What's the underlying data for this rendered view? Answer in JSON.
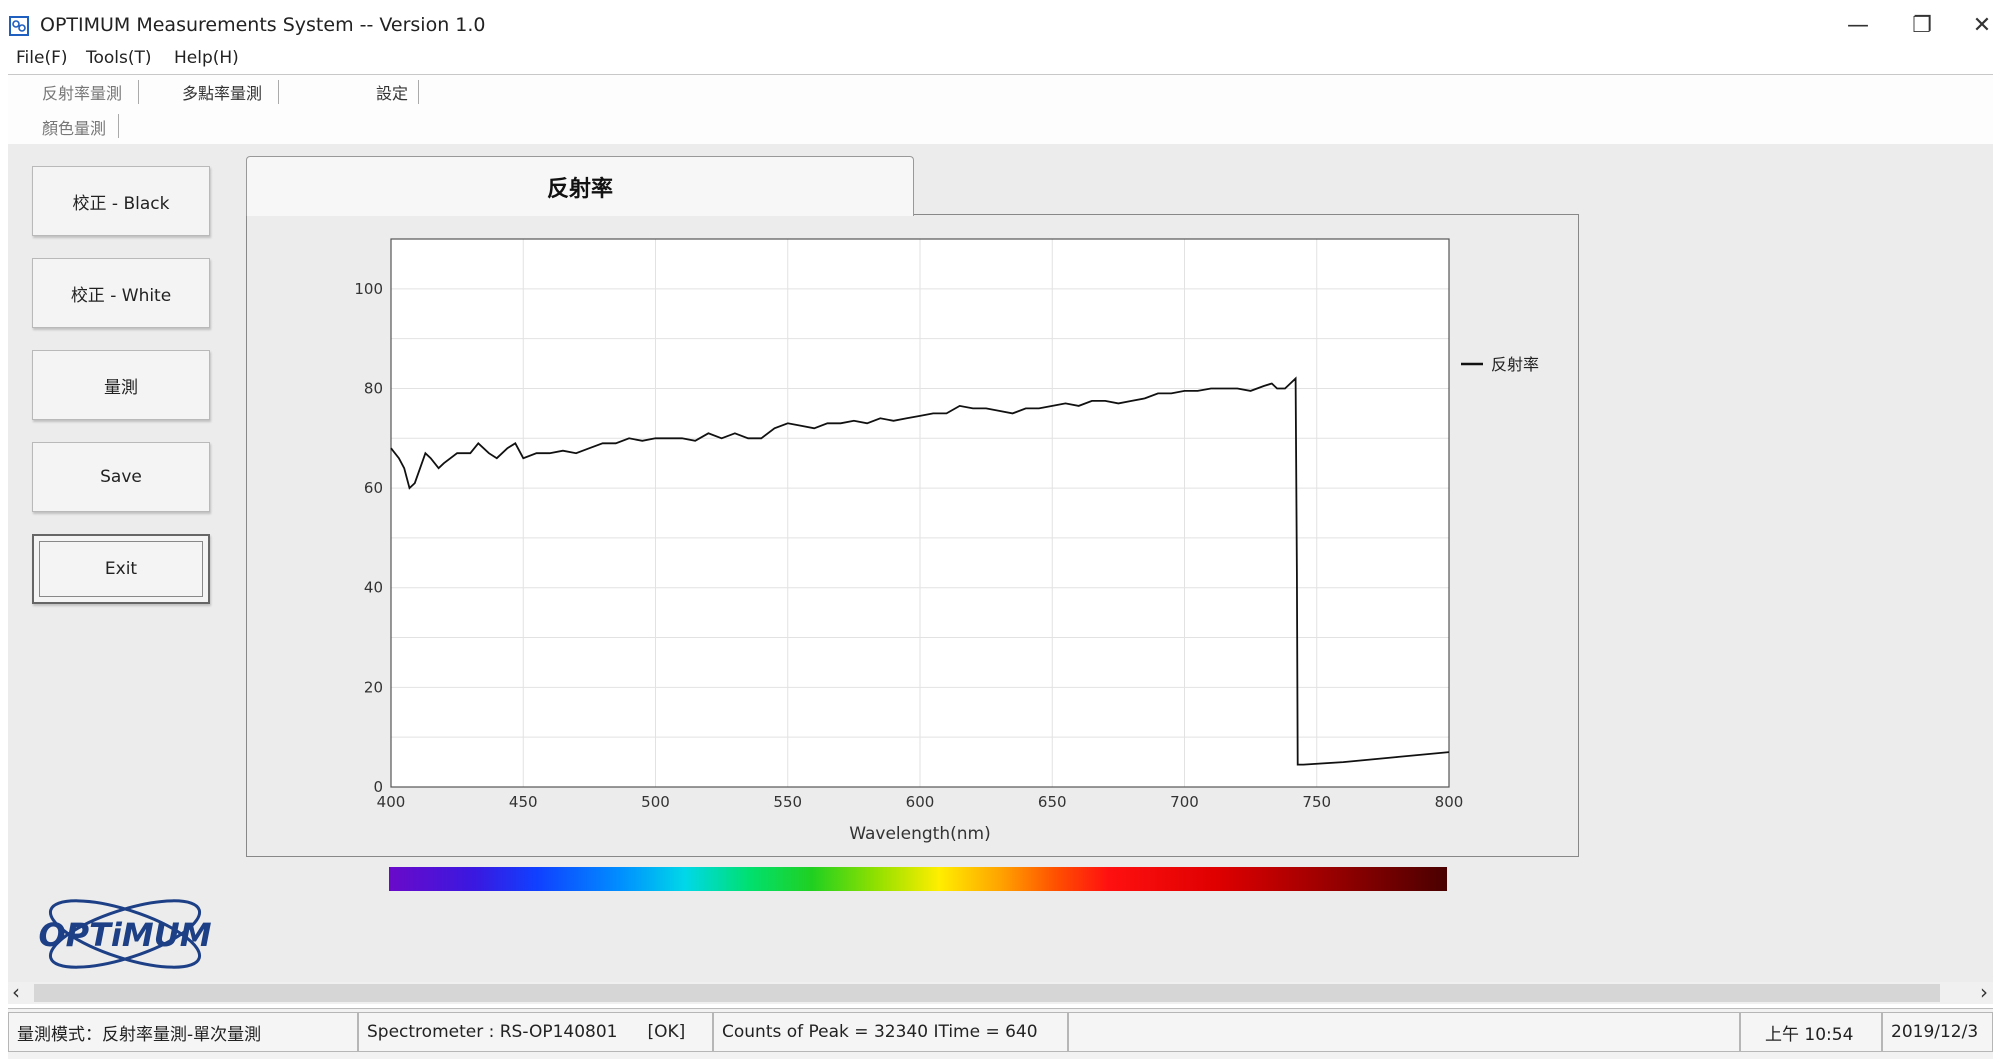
{
  "window": {
    "title": "OPTIMUM Measurements System -- Version 1.0",
    "minimize_glyph": "—",
    "restore_glyph": "❐",
    "close_glyph": "✕"
  },
  "menu": [
    {
      "label": "File(F)"
    },
    {
      "label": "Tools(T)"
    },
    {
      "label": "Help(H)"
    }
  ],
  "toolbar": {
    "tabs_row1": [
      {
        "label": "反射率量測"
      },
      {
        "label": "多點率量測"
      },
      {
        "label": "設定"
      }
    ],
    "tabs_row2": [
      {
        "label": "顏色量測"
      }
    ]
  },
  "sidebar": {
    "buttons": [
      {
        "label": "校正 - Black"
      },
      {
        "label": "校正 - White"
      },
      {
        "label": "量測"
      },
      {
        "label": "Save"
      },
      {
        "label": "Exit"
      }
    ]
  },
  "chart_tab": {
    "label": "反射率"
  },
  "chart_data": {
    "type": "line",
    "title": "",
    "xlabel": "Wavelength(nm)",
    "ylabel": "",
    "xlim": [
      400,
      800
    ],
    "ylim": [
      0,
      110
    ],
    "xticks": [
      400,
      450,
      500,
      550,
      600,
      650,
      700,
      750,
      800
    ],
    "yticks": [
      0,
      20,
      40,
      60,
      80,
      100
    ],
    "grid": true,
    "legend_position": "right",
    "series": [
      {
        "name": "反射率",
        "color": "#111111",
        "points": [
          [
            400,
            68
          ],
          [
            403,
            66
          ],
          [
            405,
            64
          ],
          [
            407,
            60
          ],
          [
            409,
            61
          ],
          [
            411,
            64
          ],
          [
            413,
            67
          ],
          [
            415,
            66
          ],
          [
            418,
            64
          ],
          [
            420,
            65
          ],
          [
            425,
            67
          ],
          [
            430,
            67
          ],
          [
            433,
            69
          ],
          [
            437,
            67
          ],
          [
            440,
            66
          ],
          [
            444,
            68
          ],
          [
            447,
            69
          ],
          [
            450,
            66
          ],
          [
            455,
            67
          ],
          [
            460,
            67
          ],
          [
            465,
            67.5
          ],
          [
            470,
            67
          ],
          [
            475,
            68
          ],
          [
            480,
            69
          ],
          [
            485,
            69
          ],
          [
            490,
            70
          ],
          [
            495,
            69.5
          ],
          [
            500,
            70
          ],
          [
            510,
            70
          ],
          [
            515,
            69.5
          ],
          [
            520,
            71
          ],
          [
            525,
            70
          ],
          [
            530,
            71
          ],
          [
            535,
            70
          ],
          [
            540,
            70
          ],
          [
            545,
            72
          ],
          [
            550,
            73
          ],
          [
            555,
            72.5
          ],
          [
            560,
            72
          ],
          [
            565,
            73
          ],
          [
            570,
            73
          ],
          [
            575,
            73.5
          ],
          [
            580,
            73
          ],
          [
            585,
            74
          ],
          [
            590,
            73.5
          ],
          [
            595,
            74
          ],
          [
            600,
            74.5
          ],
          [
            605,
            75
          ],
          [
            610,
            75
          ],
          [
            615,
            76.5
          ],
          [
            620,
            76
          ],
          [
            625,
            76
          ],
          [
            630,
            75.5
          ],
          [
            635,
            75
          ],
          [
            640,
            76
          ],
          [
            645,
            76
          ],
          [
            650,
            76.5
          ],
          [
            655,
            77
          ],
          [
            660,
            76.5
          ],
          [
            665,
            77.5
          ],
          [
            670,
            77.5
          ],
          [
            675,
            77
          ],
          [
            680,
            77.5
          ],
          [
            685,
            78
          ],
          [
            690,
            79
          ],
          [
            695,
            79
          ],
          [
            700,
            79.5
          ],
          [
            705,
            79.5
          ],
          [
            710,
            80
          ],
          [
            715,
            80
          ],
          [
            720,
            80
          ],
          [
            725,
            79.5
          ],
          [
            730,
            80.5
          ],
          [
            733,
            81
          ],
          [
            735,
            80
          ],
          [
            738,
            80
          ],
          [
            740,
            81
          ],
          [
            742,
            82
          ],
          [
            742.5,
            43
          ],
          [
            742.8,
            4.5
          ],
          [
            745,
            4.5
          ],
          [
            760,
            5
          ],
          [
            780,
            6
          ],
          [
            800,
            7
          ]
        ]
      }
    ]
  },
  "logo": {
    "text": "OPTiMUM"
  },
  "statusbar": {
    "mode": "量測模式：反射率量測-單次量測",
    "spectrometer": "Spectrometer : RS-OP140801",
    "spectrometer_status": "[OK]",
    "counts": "Counts of Peak = 32340   ITime = 640",
    "time": "上午 10:54",
    "date": "2019/12/3"
  },
  "colors": {
    "panel_bg": "#ececec",
    "line": "#111111",
    "grid": "#e2e2e2"
  }
}
